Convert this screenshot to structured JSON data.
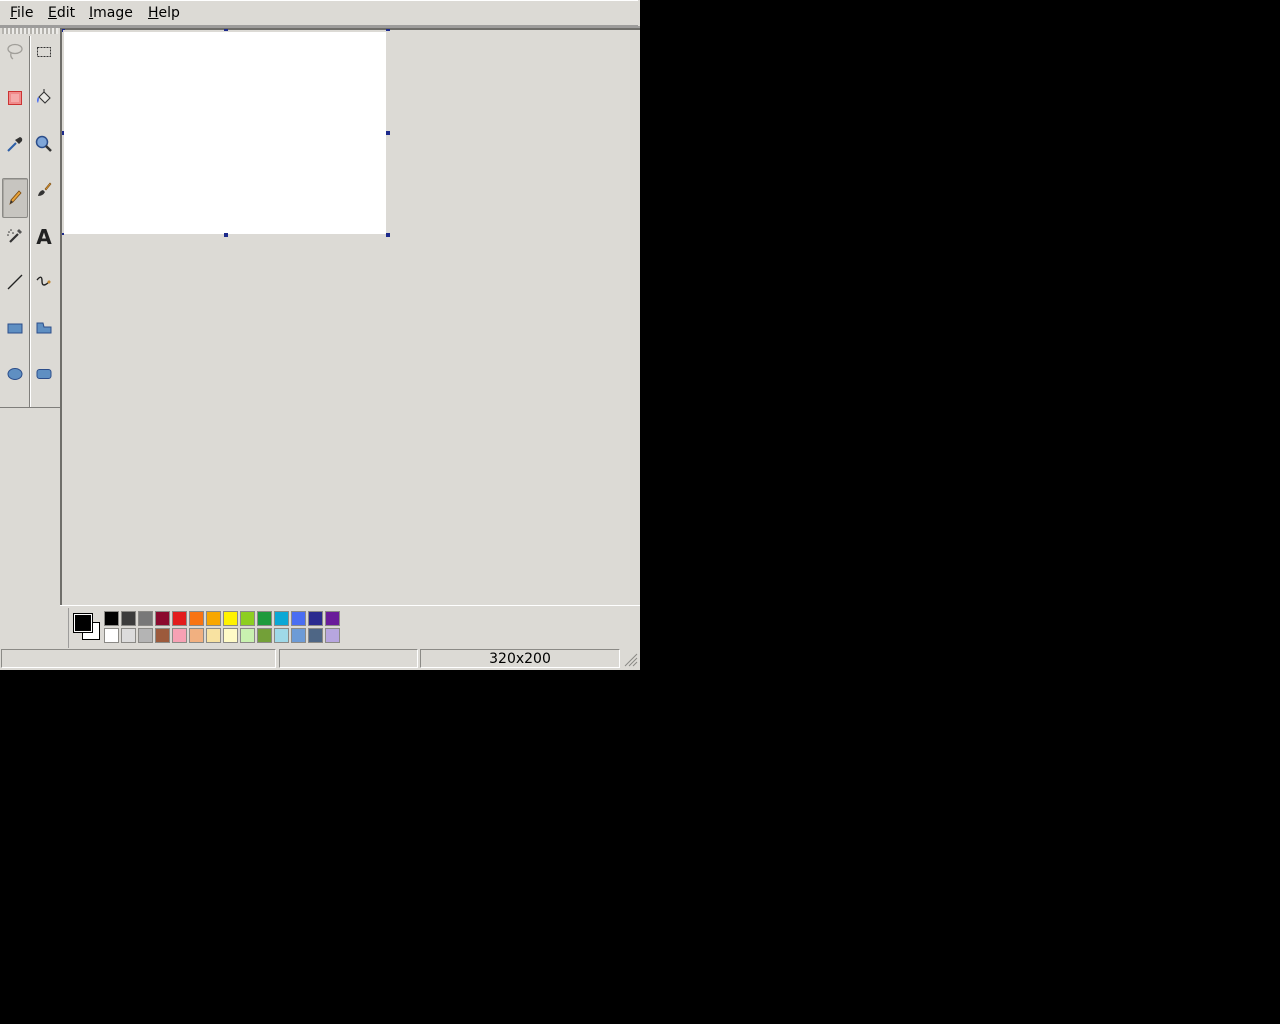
{
  "menus": [
    {
      "label_rest": "ile",
      "label_mnemonic": "F",
      "name": "menu-file"
    },
    {
      "label_rest": "dit",
      "label_mnemonic": "E",
      "name": "menu-edit"
    },
    {
      "label_rest": "mage",
      "label_mnemonic": "I",
      "name": "menu-image"
    },
    {
      "label_rest": "elp",
      "label_mnemonic": "H",
      "name": "menu-help"
    }
  ],
  "tools": [
    {
      "name": "free-select",
      "icon": "lasso-icon"
    },
    {
      "name": "rectangle-select",
      "icon": "rect-select-icon"
    },
    {
      "name": "eraser",
      "icon": "eraser-icon"
    },
    {
      "name": "fill",
      "icon": "bucket-icon"
    },
    {
      "name": "color-picker",
      "icon": "eyedropper-icon"
    },
    {
      "name": "zoom",
      "icon": "magnifier-icon"
    },
    {
      "name": "pencil",
      "icon": "pencil-icon",
      "active": true
    },
    {
      "name": "brush",
      "icon": "brush-icon"
    },
    {
      "name": "airbrush",
      "icon": "airbrush-icon"
    },
    {
      "name": "text",
      "icon": "text-icon"
    },
    {
      "name": "line",
      "icon": "line-icon"
    },
    {
      "name": "curve",
      "icon": "curve-icon"
    },
    {
      "name": "rectangle",
      "icon": "rectangle-icon"
    },
    {
      "name": "polygon",
      "icon": "polygon-icon"
    },
    {
      "name": "ellipse",
      "icon": "ellipse-icon"
    },
    {
      "name": "rounded-rectangle",
      "icon": "rounded-rect-icon"
    }
  ],
  "colors": {
    "foreground": "#000000",
    "background": "#ffffff",
    "palette_top": [
      "#000000",
      "#3c3c3c",
      "#787878",
      "#8b0a2e",
      "#e21c1c",
      "#f97412",
      "#f8a700",
      "#fff200",
      "#8dce21",
      "#1d9a3c",
      "#0aa8d6",
      "#4a6ef2",
      "#2b2b8f",
      "#6a1c9a"
    ],
    "palette_bottom": [
      "#ffffff",
      "#dcdcdc",
      "#b4b4b4",
      "#9c5a3c",
      "#f7a1b4",
      "#f1b080",
      "#f8e2a1",
      "#fffbc7",
      "#c9f2b0",
      "#73a038",
      "#9fd9e8",
      "#6d9bd6",
      "#4e6685",
      "#b7a6df"
    ]
  },
  "status": {
    "message": "",
    "position": "",
    "image_size": "320x200"
  }
}
